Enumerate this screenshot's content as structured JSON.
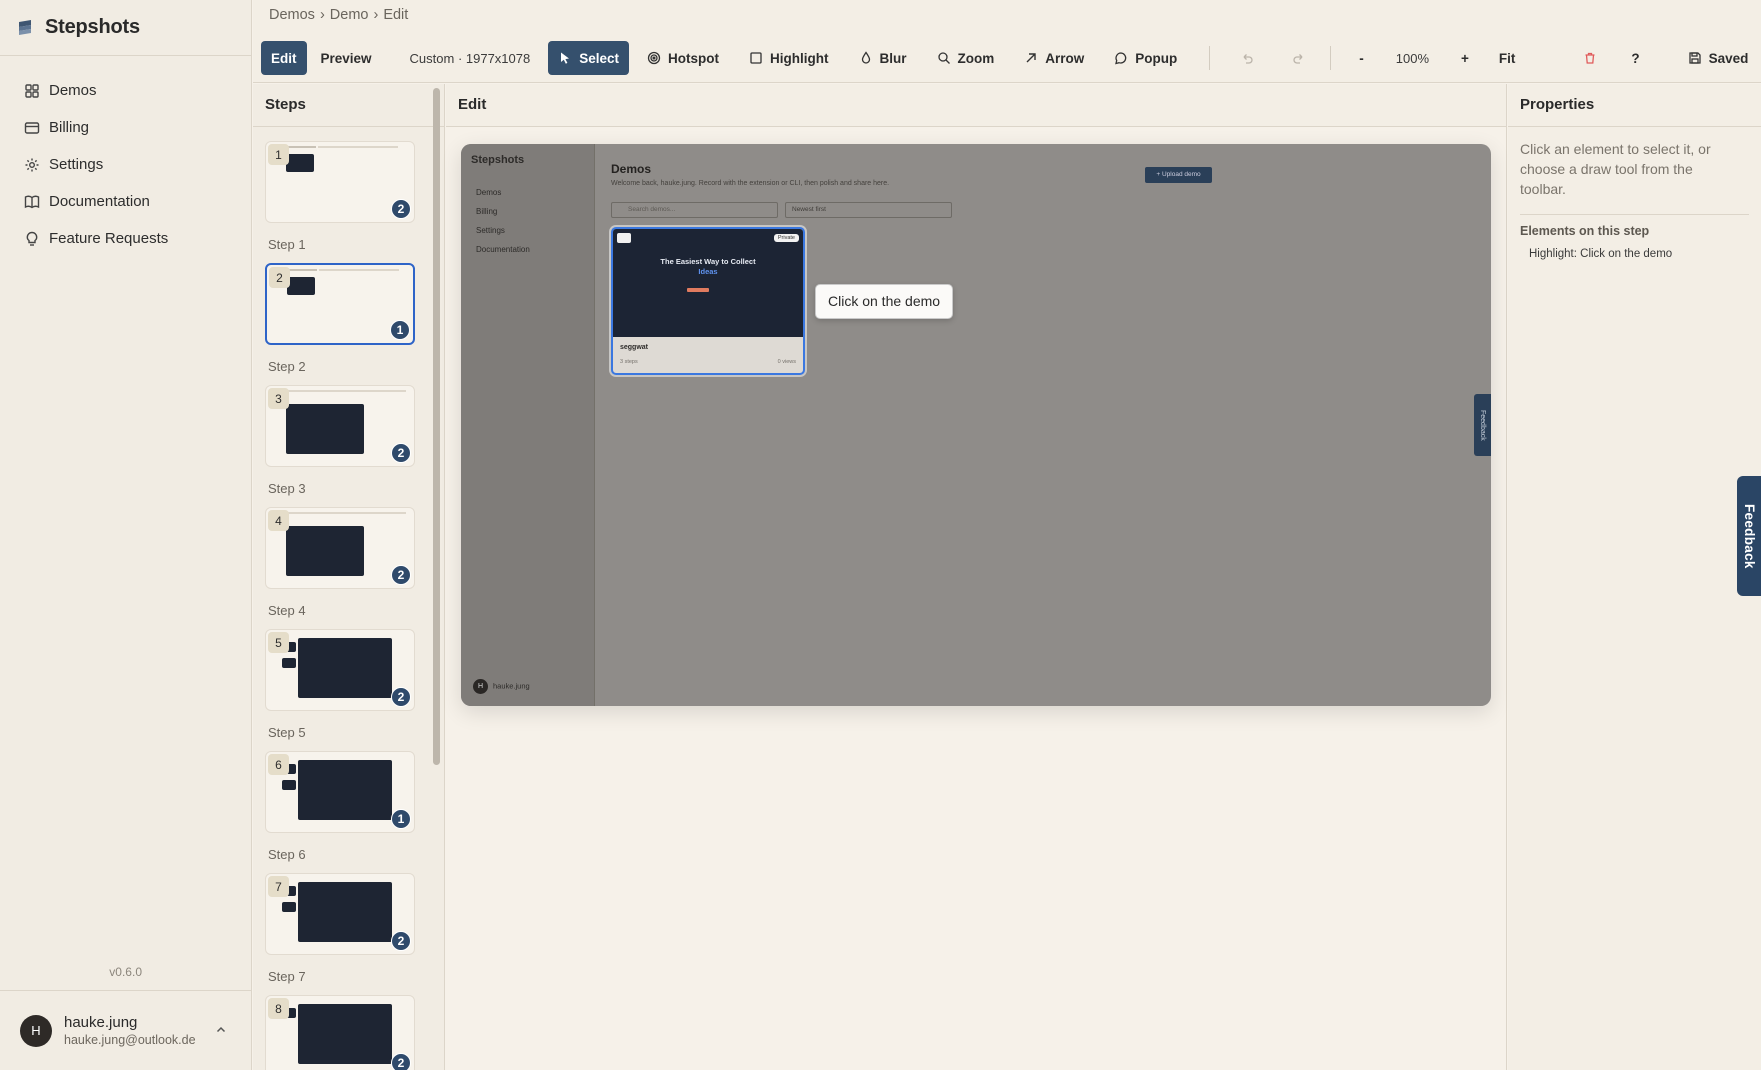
{
  "app": {
    "name": "Stepshots",
    "version": "v0.6.0"
  },
  "sidebar": {
    "items": [
      {
        "label": "Demos",
        "icon": "grid-icon"
      },
      {
        "label": "Billing",
        "icon": "card-icon"
      },
      {
        "label": "Settings",
        "icon": "gear-icon"
      },
      {
        "label": "Documentation",
        "icon": "book-icon"
      },
      {
        "label": "Feature Requests",
        "icon": "lightbulb-icon"
      }
    ]
  },
  "user": {
    "initial": "H",
    "name": "hauke.jung",
    "email": "hauke.jung@outlook.de"
  },
  "breadcrumb": [
    "Demos",
    "Demo",
    "Edit"
  ],
  "toolbar": {
    "edit": "Edit",
    "preview": "Preview",
    "size": "Custom · 1977x1078",
    "select": "Select",
    "hotspot": "Hotspot",
    "highlight": "Highlight",
    "blur": "Blur",
    "zoom": "Zoom",
    "arrow": "Arrow",
    "popup": "Popup",
    "zoom_out": "-",
    "zoom_level": "100%",
    "zoom_in": "+",
    "fit": "Fit",
    "help": "?",
    "saved": "Saved",
    "accent": "#35506d"
  },
  "steps_panel": {
    "title": "Steps",
    "steps": [
      {
        "num": "1",
        "label": "Step 1",
        "count": "2"
      },
      {
        "num": "2",
        "label": "Step 2",
        "count": "1",
        "selected": true
      },
      {
        "num": "3",
        "label": "Step 3",
        "count": "2"
      },
      {
        "num": "4",
        "label": "Step 4",
        "count": "2"
      },
      {
        "num": "5",
        "label": "Step 5",
        "count": "2"
      },
      {
        "num": "6",
        "label": "Step 6",
        "count": "1"
      },
      {
        "num": "7",
        "label": "Step 7",
        "count": "2"
      },
      {
        "num": "8",
        "label": "",
        "count": "2"
      }
    ]
  },
  "edit_panel": {
    "title": "Edit",
    "screenshot": {
      "brand": "Stepshots",
      "nav": [
        "Demos",
        "Billing",
        "Settings",
        "Documentation"
      ],
      "title": "Demos",
      "subtitle": "Welcome back, hauke.jung. Record with the extension or CLI, then polish and share here.",
      "upload": "+ Upload demo",
      "search_placeholder": "Search demos...",
      "sort": "Newest first",
      "card": {
        "badge": "Private",
        "headline": "The Easiest Way to Collect",
        "headline_accent": "Ideas",
        "name": "seggwat",
        "steps": "3 steps",
        "views": "0 views"
      },
      "feedback": "Feedback",
      "user_name": "hauke.jung",
      "user_email": "hauke.jung@outlook.de",
      "user_initial": "H"
    },
    "popup_text": "Click on the demo"
  },
  "properties": {
    "title": "Properties",
    "hint": "Click an element to select it, or choose a draw tool from the toolbar.",
    "elements_title": "Elements on this step",
    "elements": [
      "Highlight: Click on the demo"
    ]
  },
  "feedback_tab": "Feedback"
}
